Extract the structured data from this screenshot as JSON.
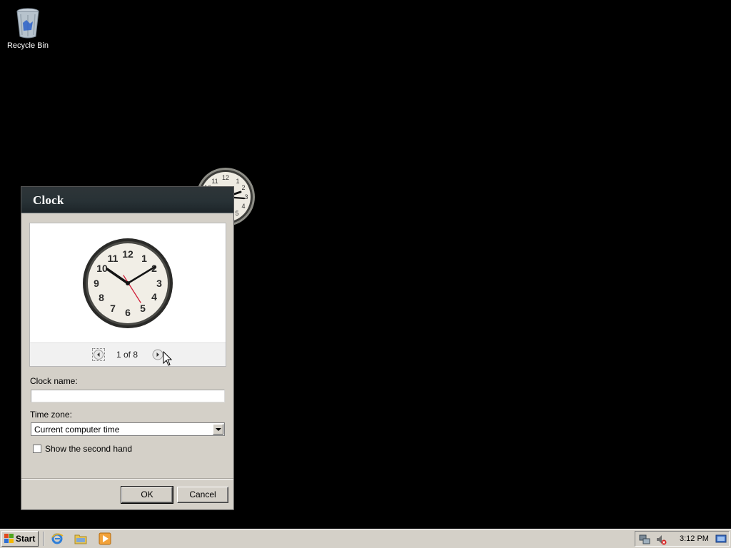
{
  "desktop": {
    "recycle_bin_label": "Recycle Bin"
  },
  "gadget": {
    "name": "clock-gadget",
    "time": "3:12"
  },
  "dialog": {
    "title": "Clock",
    "preview": {
      "page_indicator": "1 of 8",
      "prev_icon": "chevron-left-icon",
      "next_icon": "chevron-right-icon"
    },
    "clock_name": {
      "label": "Clock name:",
      "value": ""
    },
    "time_zone": {
      "label": "Time zone:",
      "selected": "Current computer time"
    },
    "second_hand": {
      "label": "Show the second hand",
      "checked": false
    },
    "buttons": {
      "ok": "OK",
      "cancel": "Cancel"
    }
  },
  "taskbar": {
    "start_label": "Start",
    "quick_launch": [
      "internet-explorer-icon",
      "folder-icon",
      "media-player-icon"
    ],
    "tray_icons": [
      "network-icon",
      "volume-muted-icon",
      "show-desktop-icon"
    ],
    "clock": "3:12 PM"
  },
  "colors": {
    "desktop_background": "#000000",
    "dialog_title_bar": "#283236",
    "dialog_body": "#d4d0c8",
    "taskbar": "#d4d0c8",
    "second_hand": "#d0203a"
  }
}
